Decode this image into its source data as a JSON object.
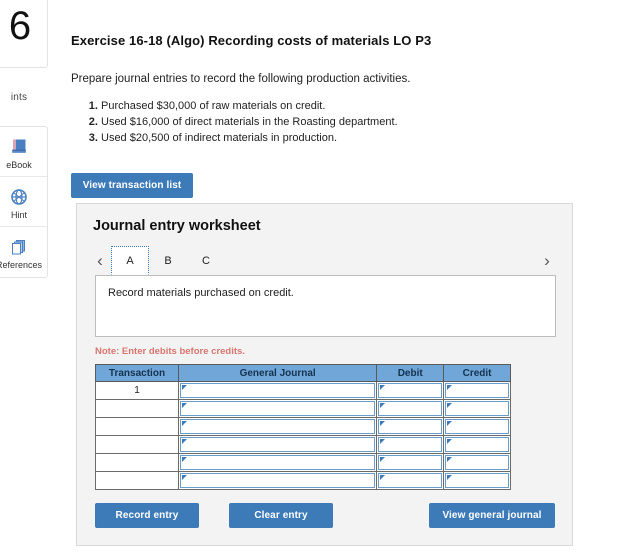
{
  "rail": {
    "points_value": "6",
    "points_label": "ints",
    "tools": [
      {
        "label": "eBook",
        "icon": "book-icon"
      },
      {
        "label": "Hint",
        "icon": "globe-icon"
      },
      {
        "label": "References",
        "icon": "pages-icon"
      }
    ]
  },
  "exercise": {
    "title": "Exercise 16-18 (Algo) Recording costs of materials LO P3",
    "prompt": "Prepare journal entries to record the following production activities.",
    "activities": [
      "Purchased $30,000 of raw materials on credit.",
      "Used $16,000 of direct materials in the Roasting department.",
      "Used $20,500 of indirect materials in production."
    ],
    "view_transaction_list_label": "View transaction list"
  },
  "worksheet": {
    "title": "Journal entry worksheet",
    "prev_arrow": "‹",
    "next_arrow": "›",
    "tabs": [
      {
        "label": "A",
        "active": true
      },
      {
        "label": "B",
        "active": false
      },
      {
        "label": "C",
        "active": false
      }
    ],
    "description": "Record materials purchased on credit.",
    "note": "Note: Enter debits before credits.",
    "table": {
      "headers": [
        "Transaction",
        "General Journal",
        "Debit",
        "Credit"
      ],
      "rows": [
        {
          "transaction": "1",
          "general_journal": "",
          "debit": "",
          "credit": ""
        },
        {
          "transaction": "",
          "general_journal": "",
          "debit": "",
          "credit": ""
        },
        {
          "transaction": "",
          "general_journal": "",
          "debit": "",
          "credit": ""
        },
        {
          "transaction": "",
          "general_journal": "",
          "debit": "",
          "credit": ""
        },
        {
          "transaction": "",
          "general_journal": "",
          "debit": "",
          "credit": ""
        },
        {
          "transaction": "",
          "general_journal": "",
          "debit": "",
          "credit": ""
        }
      ]
    },
    "buttons": {
      "record_entry": "Record entry",
      "clear_entry": "Clear entry",
      "view_general_journal": "View general journal"
    }
  },
  "colors": {
    "primary_blue": "#3c7ab8",
    "header_blue": "#71a6d8",
    "note_red": "#d9756f",
    "panel_gray": "#f3f3f3"
  }
}
